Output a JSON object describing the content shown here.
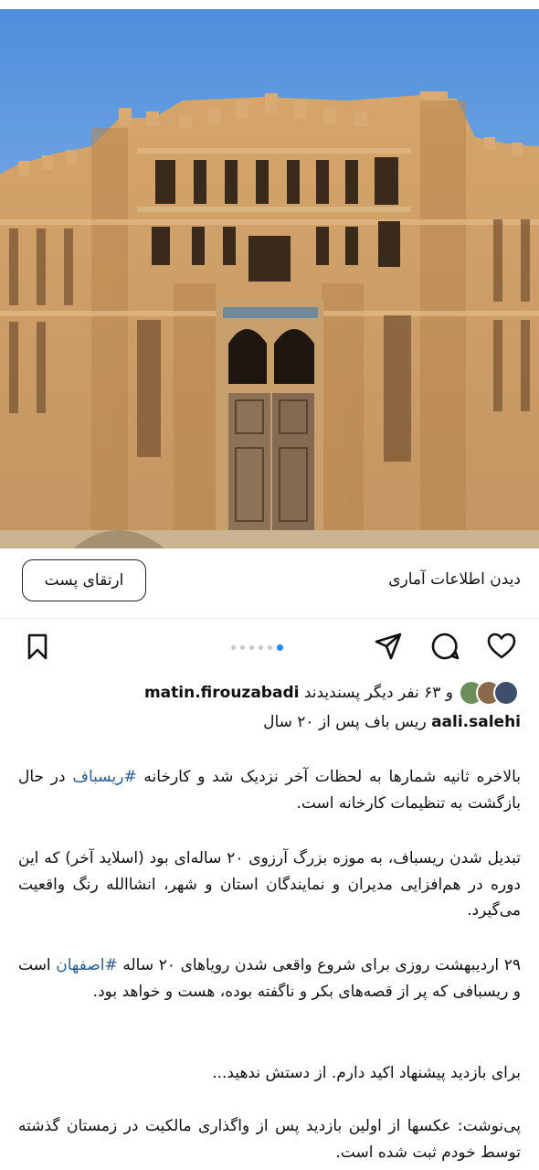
{
  "insights": {
    "view_label": "دیدن اطلاعات آماری",
    "boost_label": "ارتقای پست"
  },
  "carousel": {
    "count": 6,
    "active_index": 5
  },
  "likes": {
    "liked_by_user": "matin.firouzabadi",
    "others_text": "و ۶۳ نفر دیگر پسندیدند"
  },
  "caption": {
    "username": "aali.salehi",
    "title": "ریس باف پس از ۲۰ سال",
    "p1_text": "بالاخره ثانیه شمارها به لحظات آخر نزدیک شد و کارخانه ",
    "p1_tag": "#ریسباف",
    "p1_text2": " در حال بازگشت به تنظیمات کارخانه است.",
    "p2": "تبدیل شدن ریسباف، به موزه بزرگ آرزوی ۲۰ ساله‌ای بود (اسلاید آخر) که این دوره در هم‌افزایی مدیران و نمایندگان استان و شهر، انشاالله رنگ واقعیت می‌گیرد.",
    "p3_text": "۲۹ اردیبهشت روزی برای شروع واقعی شدن رویاهای ۲۰ ساله ",
    "p3_tag": "#اصفهان",
    "p3_text2": " است و ریسبافی که پر از قصه‌های بکر و ناگفته بوده، هست و خواهد بود.",
    "p4": "برای بازدید پیشنهاد اکید دارم. از دستش ندهید...",
    "p5": "پی‌نوشت: عکسها از اولین بازدید پس از واگذاری مالکیت در زمستان گذشته توسط خودم ثبت شده است."
  },
  "colors": {
    "hashtag": "#2b5a8e",
    "dot_active": "#1a8cff",
    "sky": "#5b9ae0",
    "brick": "#c89a62"
  }
}
